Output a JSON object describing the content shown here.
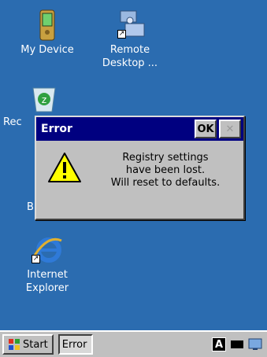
{
  "desktop": {
    "icons": [
      {
        "id": "my-device",
        "label": "My Device"
      },
      {
        "id": "remote-desktop",
        "label": "Remote\nDesktop ..."
      },
      {
        "id": "recycle-bin",
        "label": "Rec"
      },
      {
        "id": "internet-explorer",
        "label": "Internet\nExplorer"
      }
    ],
    "partial_labels": [
      "B"
    ]
  },
  "dialog": {
    "title": "Error",
    "ok_label": "OK",
    "close_label": "✕",
    "icon": "warning-icon",
    "message": "Registry settings\n   have been lost.\nWill reset to defaults."
  },
  "taskbar": {
    "start_label": "Start",
    "task_label": "Error",
    "ime_label": "A"
  },
  "colors": {
    "desktop": "#2b6cb0",
    "titlebar": "#000080",
    "chrome": "#c0c0c0"
  }
}
